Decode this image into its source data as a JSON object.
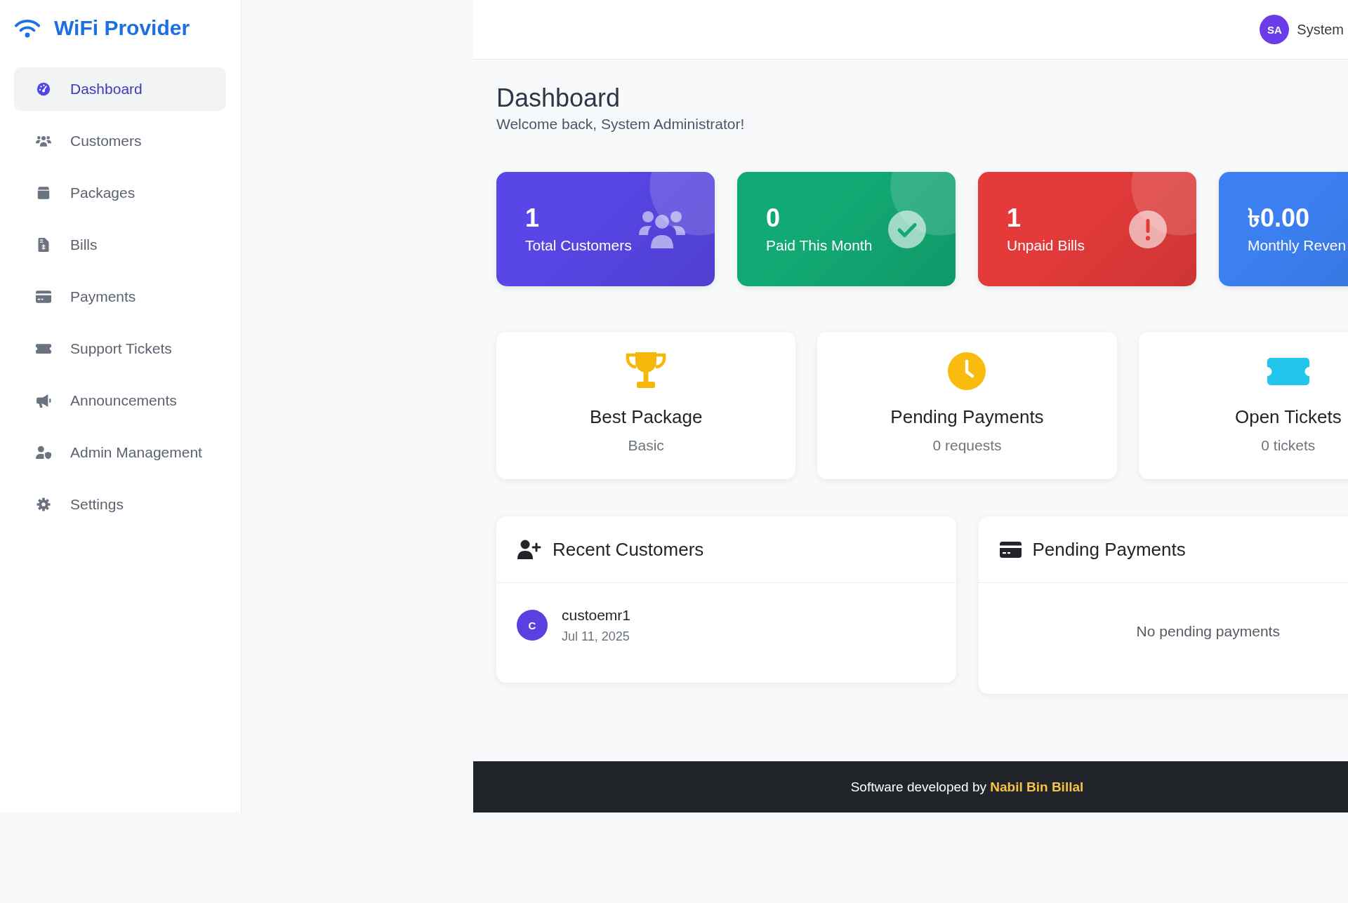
{
  "sidebar": {
    "brand": "WiFi Provider",
    "items": [
      {
        "kind": "dashboard",
        "label": "Dashboard",
        "selected": true
      },
      {
        "kind": "customers",
        "label": "Customers",
        "selected": false
      },
      {
        "kind": "packages",
        "label": "Packages",
        "selected": false
      },
      {
        "kind": "bills",
        "label": "Bills",
        "selected": false
      },
      {
        "kind": "payments",
        "label": "Payments",
        "selected": false
      },
      {
        "kind": "tickets",
        "label": "Support Tickets",
        "selected": false
      },
      {
        "kind": "announcements",
        "label": "Announcements",
        "selected": false
      },
      {
        "kind": "admins",
        "label": "Admin Management",
        "selected": false
      },
      {
        "kind": "settings",
        "label": "Settings",
        "selected": false
      }
    ]
  },
  "header": {
    "initials": "SA",
    "user_name": "System"
  },
  "page": {
    "title": "Dashboard",
    "subtitle": "Welcome back, System Administrator!"
  },
  "stats": [
    {
      "kind": "customers",
      "value": "1",
      "label": "Total Customers",
      "color": "#5846e6"
    },
    {
      "kind": "paid",
      "value": "0",
      "label": "Paid This Month",
      "color": "#12aa74"
    },
    {
      "kind": "unpaid",
      "value": "1",
      "label": "Unpaid Bills",
      "color": "#e53a3a"
    },
    {
      "kind": "revenue",
      "value": "৳0.00",
      "label": "Monthly Reven",
      "color": "#3b7ff0"
    }
  ],
  "highlights": [
    {
      "kind": "package",
      "title": "Best Package",
      "value": "Basic"
    },
    {
      "kind": "payments",
      "title": "Pending Payments",
      "value": "0 requests"
    },
    {
      "kind": "tickets",
      "title": "Open Tickets",
      "value": "0 tickets"
    }
  ],
  "panels": [
    {
      "kind": "customers",
      "title": "Recent Customers",
      "customers": [
        {
          "initial": "C",
          "name": "custoemr1",
          "date": "Jul 11, 2025"
        }
      ]
    },
    {
      "kind": "payments",
      "title": "Pending Payments",
      "empty_text": "No pending payments"
    }
  ],
  "footer": {
    "text": "Software developed by **Nabil Bin Billal**"
  }
}
